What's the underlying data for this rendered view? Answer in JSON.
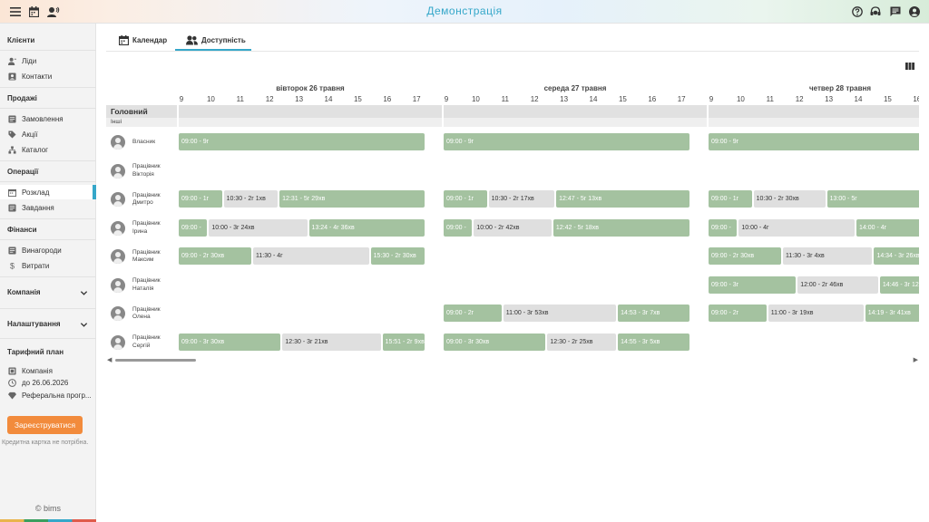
{
  "app": {
    "title": "Демонстрація"
  },
  "top_icons": {
    "left": [
      "menu-icon",
      "calendar-icon",
      "user-voice-icon"
    ],
    "right": [
      "help-icon",
      "support-icon",
      "chat-icon",
      "account-icon"
    ]
  },
  "sidebar": {
    "clients": {
      "title": "Клієнти",
      "items": [
        "Ліди",
        "Контакти"
      ]
    },
    "sales": {
      "title": "Продажі",
      "items": [
        "Замовлення",
        "Акції",
        "Каталог"
      ]
    },
    "operations": {
      "title": "Операції",
      "items": [
        "Розклад",
        "Завдання"
      ]
    },
    "finance": {
      "title": "Фінанси",
      "items": [
        "Винагороди",
        "Витрати"
      ]
    },
    "company": {
      "title": "Компанія"
    },
    "settings": {
      "title": "Налаштування"
    },
    "plan": {
      "title": "Тарифний план",
      "items": [
        "Компанія",
        "до 26.06.2026",
        "Реферальна прогр..."
      ]
    },
    "register_label": "Зареєструватися",
    "register_note": "Кредитна картка не потрібна.",
    "copyright": "© bims"
  },
  "tabs": [
    "Календар",
    "Доступність"
  ],
  "schedule": {
    "days": [
      "вівторок 26 травня",
      "середа 27 травня",
      "четвер 28 травня"
    ],
    "hours": [
      "9",
      "10",
      "11",
      "12",
      "13",
      "14",
      "15",
      "16",
      "17"
    ],
    "group": {
      "name": "Головний",
      "sub": "Інші"
    },
    "people": [
      {
        "name": "Власник"
      },
      {
        "name": "Працівник Вікторія"
      },
      {
        "name": "Працівник Дмитро"
      },
      {
        "name": "Працівник Ірина"
      },
      {
        "name": "Працівник Максим"
      },
      {
        "name": "Працівник Наталія"
      },
      {
        "name": "Працівник Олена"
      },
      {
        "name": "Працівник Сергій"
      }
    ],
    "segments": [
      [
        [
          [
            "g",
            9,
            17.4,
            "09:00 - 9г"
          ]
        ],
        [
          [
            "g",
            9,
            17.4,
            "09:00 - 9г"
          ]
        ],
        [
          [
            "g",
            9,
            17.4,
            "09:00 - 9г"
          ]
        ]
      ],
      [
        [],
        [],
        []
      ],
      [
        [
          [
            "g",
            9,
            10.5,
            "09:00 - 1г"
          ],
          [
            "r",
            10.5,
            12.4,
            "10:30 - 2г 1хв"
          ],
          [
            "g",
            12.4,
            17.4,
            "12:31 - 5г 29хв"
          ]
        ],
        [
          [
            "g",
            9,
            10.5,
            "09:00 - 1г"
          ],
          [
            "r",
            10.5,
            12.8,
            "10:30 - 2г 17хв"
          ],
          [
            "g",
            12.8,
            17.4,
            "12:47 - 5г 13хв"
          ]
        ],
        [
          [
            "g",
            9,
            10.5,
            "09:00 - 1г"
          ],
          [
            "r",
            10.5,
            13,
            "10:30 - 2г 30хв"
          ],
          [
            "g",
            13,
            17.4,
            "13:00 - 5г"
          ]
        ]
      ],
      [
        [
          [
            "g",
            9,
            10,
            "09:00 -"
          ],
          [
            "r",
            10,
            13.4,
            "10:00 - 3г 24хв"
          ],
          [
            "g",
            13.4,
            17.4,
            "13:24 - 4г 36хв"
          ]
        ],
        [
          [
            "g",
            9,
            10,
            "09:00 -"
          ],
          [
            "r",
            10,
            12.7,
            "10:00 - 2г 42хв"
          ],
          [
            "g",
            12.7,
            17.4,
            "12:42 - 5г 18хв"
          ]
        ],
        [
          [
            "g",
            9,
            10,
            "09:00 -"
          ],
          [
            "r",
            10,
            14,
            "10:00 - 4г"
          ],
          [
            "g",
            14,
            17.4,
            "14:00 - 4г"
          ]
        ]
      ],
      [
        [
          [
            "g",
            9,
            11.5,
            "09:00 - 2г 30хв"
          ],
          [
            "r",
            11.5,
            15.5,
            "11:30 - 4г"
          ],
          [
            "g",
            15.5,
            17.4,
            "15:30 - 2г 30хв"
          ]
        ],
        [],
        [
          [
            "g",
            9,
            11.5,
            "09:00 - 2г 30хв"
          ],
          [
            "r",
            11.5,
            14.6,
            "11:30 - 3г 4хв"
          ],
          [
            "g",
            14.6,
            17.4,
            "14:34 - 3г 26хв"
          ]
        ]
      ],
      [
        [],
        [],
        [
          [
            "g",
            9,
            12,
            "09:00 - 3г"
          ],
          [
            "r",
            12,
            14.8,
            "12:00 - 2г 46хв"
          ],
          [
            "g",
            14.8,
            17.4,
            "14:46 - 3г 12хв"
          ]
        ]
      ],
      [
        [],
        [
          [
            "g",
            9,
            11,
            "09:00 - 2г"
          ],
          [
            "r",
            11,
            14.9,
            "11:00 - 3г 53хв"
          ],
          [
            "g",
            14.9,
            17.4,
            "14:53 - 3г 7хв"
          ]
        ],
        [
          [
            "g",
            9,
            11,
            "09:00 - 2г"
          ],
          [
            "r",
            11,
            14.3,
            "11:00 - 3г 19хв"
          ],
          [
            "g",
            14.3,
            17.4,
            "14:19 - 3г 41хв"
          ]
        ]
      ],
      [
        [
          [
            "g",
            9,
            12.5,
            "09:00 - 3г 30хв"
          ],
          [
            "r",
            12.5,
            15.9,
            "12:30 - 3г 21хв"
          ],
          [
            "g",
            15.9,
            17.4,
            "15:51 - 2г 9хв"
          ]
        ],
        [
          [
            "g",
            9,
            12.5,
            "09:00 - 3г 30хв"
          ],
          [
            "r",
            12.5,
            14.9,
            "12:30 - 2г 25хв"
          ],
          [
            "g",
            14.9,
            17.4,
            "14:55 - 3г 5хв"
          ]
        ],
        []
      ]
    ]
  },
  "colors": {
    "accent": "#35a7c9",
    "available": "#a4c2a0",
    "busy": "#dfdfdf",
    "register": "#f28b3c"
  }
}
